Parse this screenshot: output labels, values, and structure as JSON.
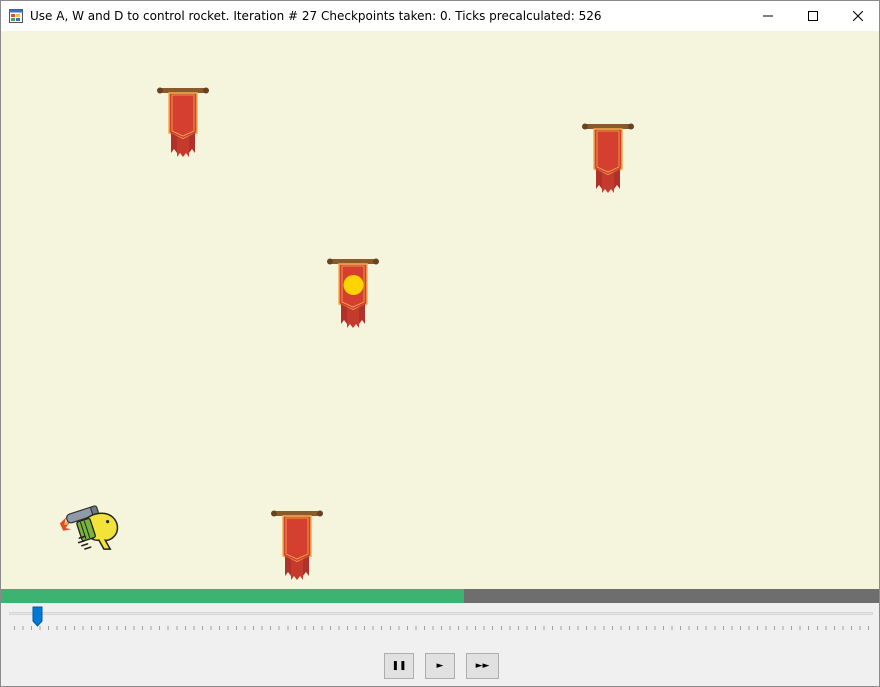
{
  "window": {
    "title": "Use A, W and D to control rocket. Iteration # 27 Checkpoints taken: 0. Ticks precalculated: 526",
    "app_icon": "winforms-app-icon",
    "buttons": [
      "minimize-icon",
      "maximize-icon",
      "close-icon"
    ]
  },
  "game": {
    "background_color": "#f5f4dc",
    "checkpoints": [
      {
        "name": "checkpoint-banner-1",
        "active": false
      },
      {
        "name": "checkpoint-banner-2",
        "active": false
      },
      {
        "name": "checkpoint-banner-3",
        "active": true,
        "marker_color": "#ffd400"
      },
      {
        "name": "checkpoint-banner-4",
        "active": false
      }
    ],
    "player": "rocket-creature-with-jetpack"
  },
  "progress": {
    "fraction": 0.527,
    "fill_color": "#3cb371",
    "track_color": "#6e6e6e"
  },
  "timeline": {
    "position_fraction": 0.033
  },
  "controls": {
    "pause_label": "❚❚",
    "play_label": "►",
    "fast_forward_label": "►►"
  }
}
